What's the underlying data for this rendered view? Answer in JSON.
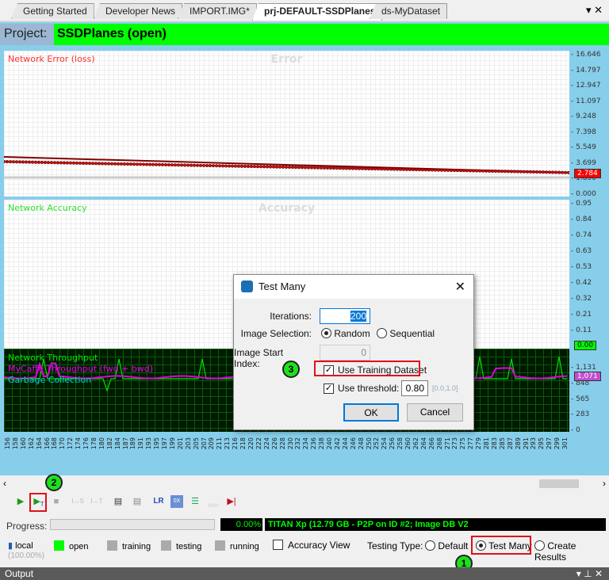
{
  "tabs": [
    {
      "label": "Getting Started"
    },
    {
      "label": "Developer News"
    },
    {
      "label": "IMPORT.IMG*"
    },
    {
      "label": "prj-DEFAULT-SSDPlanes",
      "active": true
    },
    {
      "label": "ds-MyDataset"
    }
  ],
  "tab_controls": {
    "dropdown": "▾",
    "close": "✕"
  },
  "project": {
    "label": "Project:",
    "value": "SSDPlanes (open)",
    "color": "#00ff00"
  },
  "error_panel": {
    "legend": "Network Error (loss)",
    "title": "Error",
    "y_ticks": [
      "16.646",
      "14.797",
      "12.947",
      "11.097",
      "9.248",
      "7.398",
      "5.549",
      "3.699",
      "1.850",
      "0.000"
    ],
    "current": "2.784",
    "color": "#ff0000"
  },
  "accuracy_panel": {
    "legend": "Network Accuracy",
    "title": "Accuracy",
    "y_ticks": [
      "0.95",
      "0.84",
      "0.74",
      "0.63",
      "0.53",
      "0.42",
      "0.32",
      "0.21",
      "0.11"
    ],
    "current": "0.00",
    "color": "#00ff00"
  },
  "throughput_panel": {
    "legends": [
      "Network Throughput",
      "MyCaffe Throughput (fwd + bwd)",
      "Garbage Collection"
    ],
    "legend_colors": [
      "#00e000",
      "#e000e0",
      "#00d0d0"
    ],
    "y_ticks": [
      "1,131",
      "848",
      "565",
      "283",
      "0"
    ],
    "current": "1,071"
  },
  "x_ticks": [
    "156",
    "158",
    "160",
    "162",
    "164",
    "166",
    "168",
    "170",
    "172",
    "174",
    "176",
    "178",
    "180",
    "182",
    "184",
    "187",
    "189",
    "191",
    "193",
    "195",
    "197",
    "199",
    "201",
    "203",
    "205",
    "207",
    "209",
    "211",
    "213",
    "216",
    "218",
    "220",
    "222",
    "224",
    "226",
    "228",
    "230",
    "232",
    "234",
    "236",
    "238",
    "240",
    "242",
    "244",
    "246",
    "248",
    "250",
    "252",
    "254",
    "256",
    "258",
    "260",
    "262",
    "264",
    "266",
    "268",
    "271",
    "273",
    "275",
    "277",
    "279",
    "281",
    "283",
    "285",
    "287",
    "289",
    "291",
    "293",
    "295",
    "297",
    "299",
    "301"
  ],
  "dialog": {
    "title": "Test Many",
    "iterations_label": "Iterations:",
    "iterations": "200",
    "image_selection_label": "Image Selection:",
    "random": "Random",
    "sequential": "Sequential",
    "selection": "Random",
    "start_index_label": "Image Start Index:",
    "start_index": "0",
    "use_training": "Use Training Dataset",
    "use_training_checked": true,
    "use_threshold": "Use threshold:",
    "use_threshold_checked": true,
    "threshold": "0.80",
    "threshold_range": "[0.0,1.0]",
    "ok": "OK",
    "cancel": "Cancel"
  },
  "badges": {
    "one": "1",
    "two": "2",
    "three": "3"
  },
  "toolbar": [
    "run-icon",
    "test-icon",
    "stop-icon",
    "step-s-icon",
    "step-t-icon",
    "network-icon",
    "network-refresh-icon",
    "LR",
    "weights-icon",
    "layers-icon",
    "NAN",
    "abort-icon"
  ],
  "toolbar_text": {
    "lr": "LR",
    "nan": "NAN"
  },
  "progress": {
    "label": "Progress:",
    "percent": "0.00%",
    "value": 0,
    "gpu_info": "TITAN Xp (12.79 GB - P2P on ID #2; Image DB V2"
  },
  "status": {
    "local": "local",
    "local_pct": "(100.00%)",
    "open": "open",
    "training": "training",
    "testing": "testing",
    "running": "running",
    "accuracy_view": "Accuracy View",
    "testing_type_label": "Testing Type:",
    "default": "Default",
    "test_many": "Test Many",
    "create_results": "Create Results",
    "selected": "Test Many"
  },
  "output": {
    "title": "Output"
  }
}
